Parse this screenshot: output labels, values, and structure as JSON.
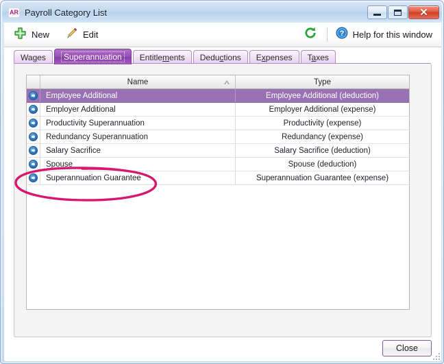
{
  "window": {
    "app_icon_text": "AR",
    "title": "Payroll Category List",
    "minimize_label": "Minimize",
    "maximize_label": "Maximize",
    "close_label": "✕"
  },
  "toolbar": {
    "new_label": "New",
    "edit_label": "Edit",
    "refresh_label": "Refresh",
    "help_label": "Help for this window"
  },
  "tabs": [
    {
      "label": "Wages",
      "pre": "Wa",
      "accel": "g",
      "post": "es",
      "active": false
    },
    {
      "label": "Superannuation",
      "pre": "",
      "accel": "",
      "post": "",
      "active": true
    },
    {
      "label": "Entitlements",
      "pre": "Entitle",
      "accel": "m",
      "post": "ents",
      "active": false
    },
    {
      "label": "Deductions",
      "pre": "Dedu",
      "accel": "c",
      "post": "tions",
      "active": false
    },
    {
      "label": "Expenses",
      "pre": "E",
      "accel": "x",
      "post": "penses",
      "active": false
    },
    {
      "label": "Taxes",
      "pre": "T",
      "accel": "a",
      "post": "xes",
      "active": false
    }
  ],
  "grid": {
    "columns": [
      "",
      "Name",
      "Type"
    ],
    "sort_column": "Name",
    "sort_direction": "ascending",
    "rows": [
      {
        "icon": "row-arrow-icon",
        "name": "Employee Additional",
        "type": "Employee Additional (deduction)",
        "selected": true
      },
      {
        "icon": "row-arrow-icon",
        "name": "Employer Additional",
        "type": "Employer Additional (expense)",
        "selected": false
      },
      {
        "icon": "row-arrow-icon",
        "name": "Productivity Superannuation",
        "type": "Productivity (expense)",
        "selected": false
      },
      {
        "icon": "row-arrow-icon",
        "name": "Redundancy Superannuation",
        "type": "Redundancy (expense)",
        "selected": false
      },
      {
        "icon": "row-arrow-icon",
        "name": "Salary Sacrifice",
        "type": "Salary Sacrifice (deduction)",
        "selected": false
      },
      {
        "icon": "row-arrow-icon",
        "name": "Spouse",
        "type": "Spouse (deduction)",
        "selected": false
      },
      {
        "icon": "row-arrow-icon",
        "name": "Superannuation Guarantee",
        "type": "Superannuation Guarantee (expense)",
        "selected": false
      }
    ]
  },
  "footer": {
    "close_label": "Close"
  },
  "annotation": {
    "type": "hand-drawn-ellipse",
    "color": "#D8186E",
    "targets": "Spouse / Superannuation Guarantee rows"
  },
  "colors": {
    "accent_purple": "#9a4fb8",
    "selection_purple": "#9a72b3",
    "annotation_pink": "#D8186E",
    "titlebar_blue": "#c3d9ef",
    "new_icon_green": "#3f9b3f",
    "refresh_green": "#2aa33a",
    "help_blue": "#2f86d0"
  }
}
